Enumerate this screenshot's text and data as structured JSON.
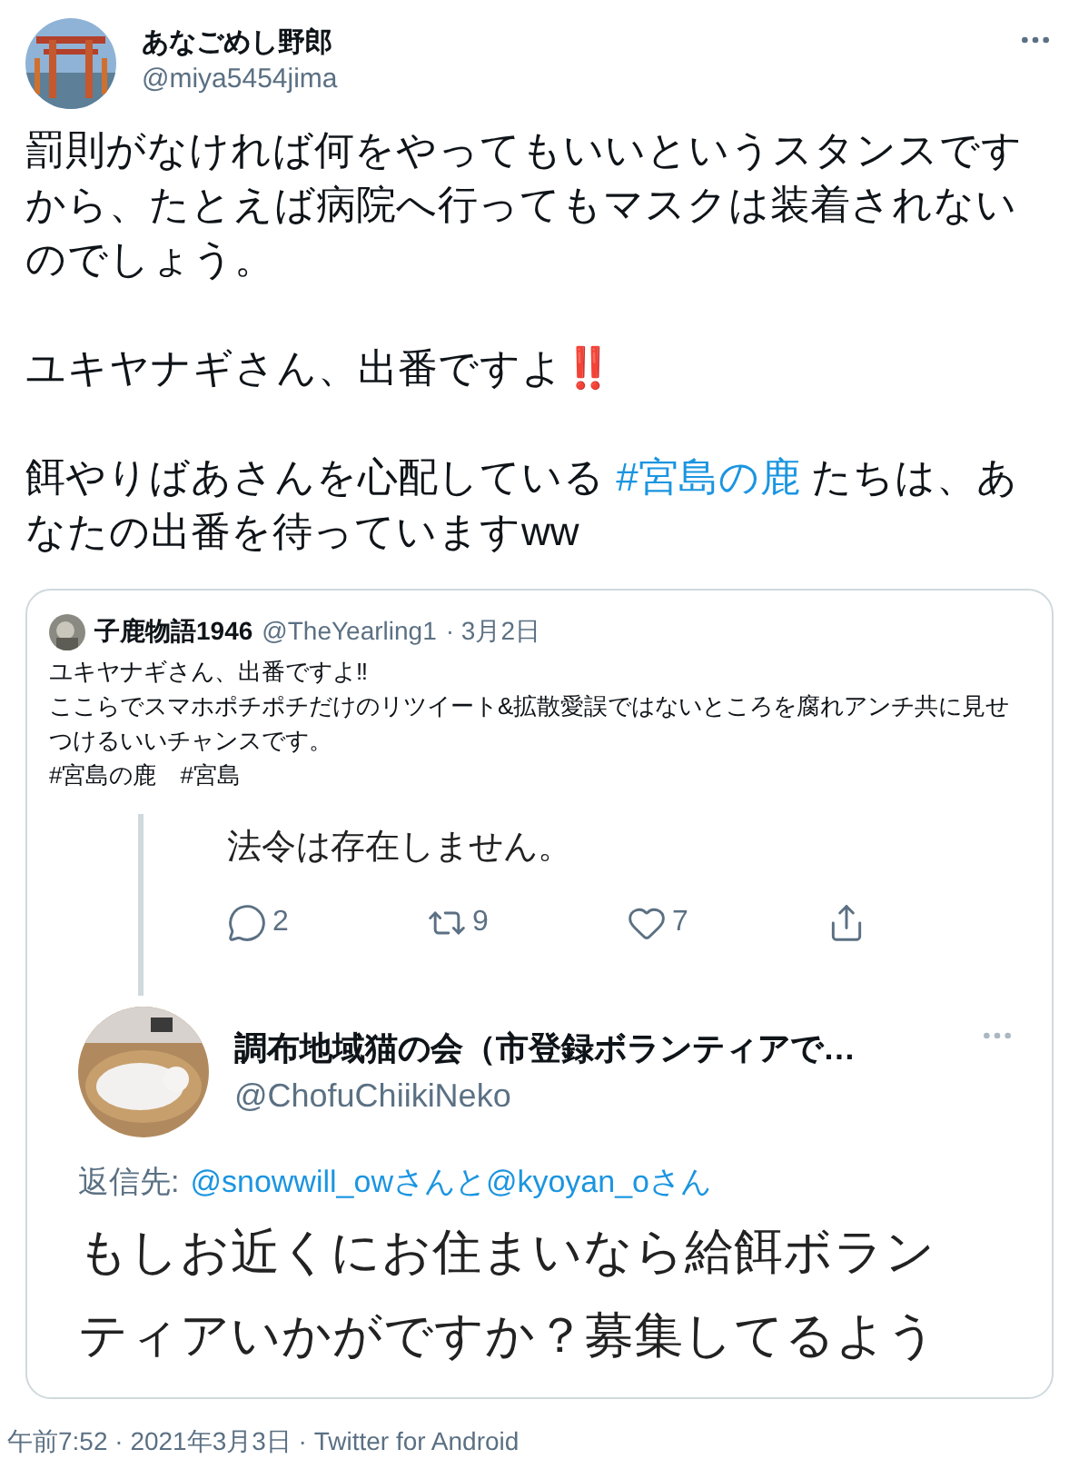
{
  "author": {
    "name": "あなごめし野郎",
    "handle": "@miya5454jima"
  },
  "body": [
    [
      {
        "kind": "text",
        "text": "罰則がなければ何をやってもいいというスタンスですから、たとえば病院へ行ってもマスクは装着されないのでしょう。"
      }
    ],
    [
      {
        "kind": "text",
        "text": "ユキヤナギさん、出番ですよ"
      },
      {
        "kind": "emoji",
        "text": "‼️"
      }
    ],
    [
      {
        "kind": "text",
        "text": "餌やりばあさんを心配している "
      },
      {
        "kind": "link",
        "text": "#宮島の鹿"
      },
      {
        "kind": "text",
        "text": " たちは、あなたの出番を待っていますww"
      }
    ]
  ],
  "quote": {
    "name": "子鹿物語1946",
    "handle": "@TheYearling1",
    "date": "· 3月2日",
    "lines": [
      "ユキヤナギさん、出番ですよ‼",
      "ここらでスマホポチポチだけのリツイート&拡散愛誤ではないところを腐れアンチ共に見せつけるいいチャンスです。",
      "#宮島の鹿　#宮島"
    ],
    "screenshot": {
      "prev_text": "法令は存在しません。",
      "actions": [
        {
          "kind": "reply",
          "count": "2"
        },
        {
          "kind": "retweet",
          "count": "9"
        },
        {
          "kind": "like",
          "count": "7"
        },
        {
          "kind": "share"
        }
      ],
      "name": "調布地域猫の会（市登録ボランティアで…",
      "handle": "@ChofuChiikiNeko",
      "reply_label": "返信先:",
      "reply_to": "@snowwill_owさんと@kyoyan_oさん",
      "text": "もしお近くにお住まいなら給餌ボランティアいかがですか？募集してるよう"
    }
  },
  "footer": "午前7:52 · 2021年3月3日 · Twitter for Android"
}
